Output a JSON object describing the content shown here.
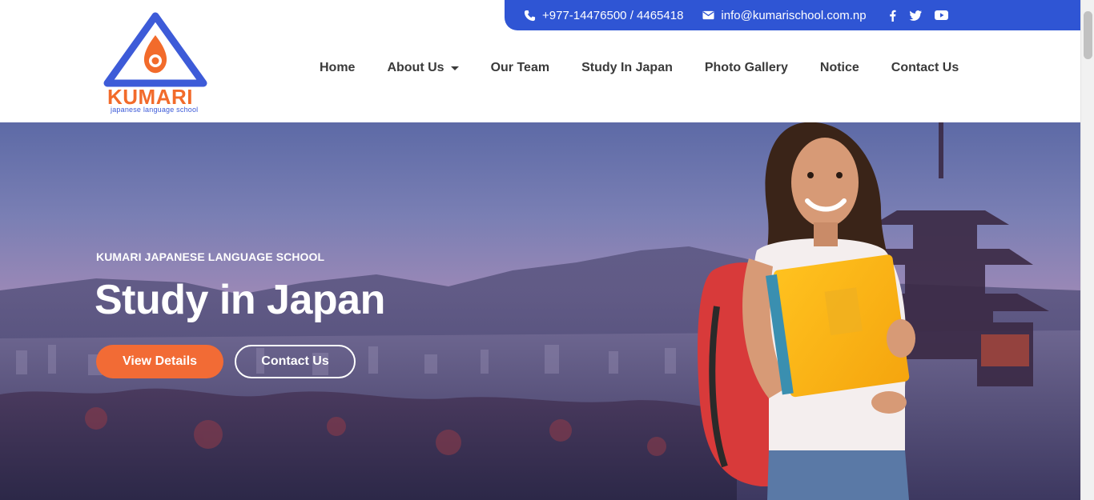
{
  "topbar": {
    "phone": "+977-14476500 / 4465418",
    "email": "info@kumarischool.com.np",
    "social_icons": [
      "facebook-icon",
      "twitter-icon",
      "youtube-icon"
    ],
    "background": "#2f55d4"
  },
  "logo": {
    "brand": "KUMARI",
    "tagline": "japanese language school",
    "triangle_color": "#3d5bd8",
    "flame_color": "#f26b2b"
  },
  "nav": {
    "items": [
      "Home",
      "About Us",
      "Our Team",
      "Study In Japan",
      "Photo Gallery",
      "Notice",
      "Contact Us"
    ]
  },
  "hero": {
    "eyebrow": "KUMARI JAPANESE LANGUAGE SCHOOL",
    "headline": "Study in Japan",
    "primary_button": "View Details",
    "secondary_button": "Contact Us",
    "accent": "#f26b35"
  }
}
